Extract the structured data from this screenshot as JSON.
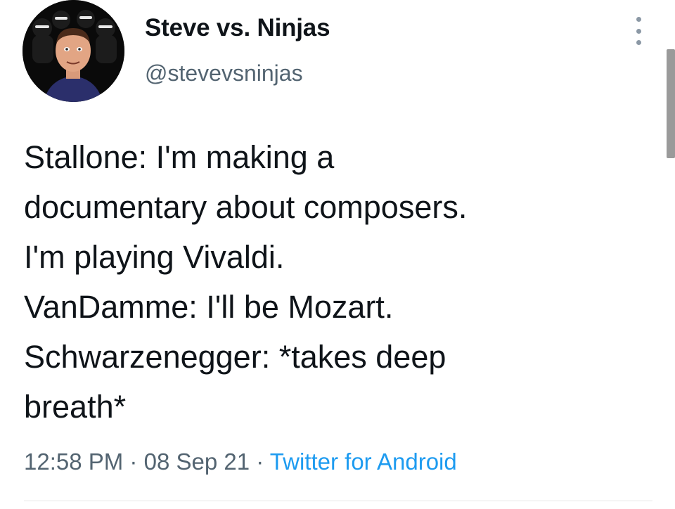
{
  "author": {
    "display_name": "Steve vs. Ninjas",
    "handle": "@stevevsninjas",
    "avatar": "cartoon-portrait-avatar"
  },
  "tweet": {
    "lines": [
      "Stallone: I'm making a",
      "documentary about composers.",
      "I'm playing Vivaldi.",
      "VanDamme: I'll be Mozart.",
      "Schwarzenegger: *takes deep",
      "breath*"
    ]
  },
  "meta": {
    "time": "12:58 PM",
    "separator": "·",
    "date": "08 Sep 21",
    "source": "Twitter for Android"
  },
  "icons": {
    "more": "more-options-icon"
  },
  "colors": {
    "text": "#0f1419",
    "secondary": "#536471",
    "link": "#1d9bf0"
  }
}
